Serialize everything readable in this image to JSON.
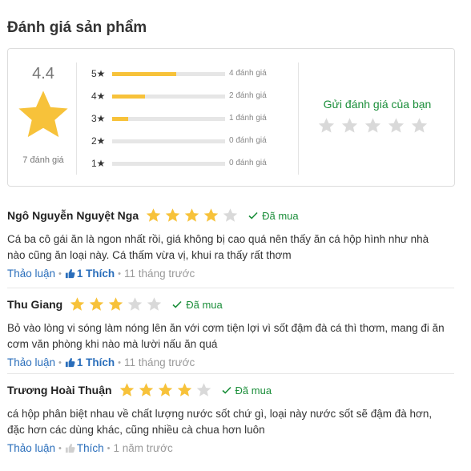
{
  "section_title": "Đánh giá sản phẩm",
  "summary": {
    "average": "4.4",
    "total_label": "7 đánh giá",
    "distribution": [
      {
        "label": "5★",
        "count_label": "4 đánh giá",
        "fraction": 0.57
      },
      {
        "label": "4★",
        "count_label": "2 đánh giá",
        "fraction": 0.29
      },
      {
        "label": "3★",
        "count_label": "1 đánh giá",
        "fraction": 0.14
      },
      {
        "label": "2★",
        "count_label": "0 đánh giá",
        "fraction": 0
      },
      {
        "label": "1★",
        "count_label": "0 đánh giá",
        "fraction": 0
      }
    ],
    "write_review_label": "Gửi đánh giá của bạn"
  },
  "colors": {
    "star": "#f7c23a",
    "star_empty": "#d9d9d9",
    "green": "#1b8e3a",
    "link": "#2a6ebb"
  },
  "icons": {
    "big_star": "star-icon",
    "bought": "check-icon",
    "like": "thumbs-up-icon"
  },
  "reviews": [
    {
      "name": "Ngô Nguyễn Nguyệt Nga",
      "rating": 4,
      "bought_label": "Đã mua",
      "text": "Cá ba cô gái ăn là ngon nhất rồi, giá không bị cao quá nên thấy ăn cá hộp hình như nhà nào cũng ăn loại này. Cá thấm vừa vị, khui ra thấy rất thơm",
      "discuss_label": "Thảo luận",
      "like_label": "1 Thích",
      "liked": true,
      "time": "11 tháng trước"
    },
    {
      "name": "Thu Giang",
      "rating": 3,
      "bought_label": "Đã mua",
      "text": "Bỏ vào lòng vi sóng làm nóng lên ăn với cơm tiện lợi vì sốt đậm đà cá thì thơm, mang đi ăn cơm văn phòng khi nào mà lười nấu ăn quá",
      "discuss_label": "Thảo luận",
      "like_label": "1 Thích",
      "liked": true,
      "time": "11 tháng trước"
    },
    {
      "name": "Trương Hoài Thuận",
      "rating": 4,
      "bought_label": "Đã mua",
      "text": "cá hộp phân biệt nhau về chất lượng nước sốt chứ gì, loại này nước sốt sẽ đậm đà hơn, đặc hơn các dùng khác, cũng nhiều cà chua hơn luôn",
      "discuss_label": "Thảo luận",
      "like_label": "Thích",
      "liked": false,
      "time": "1 năm trước"
    }
  ]
}
